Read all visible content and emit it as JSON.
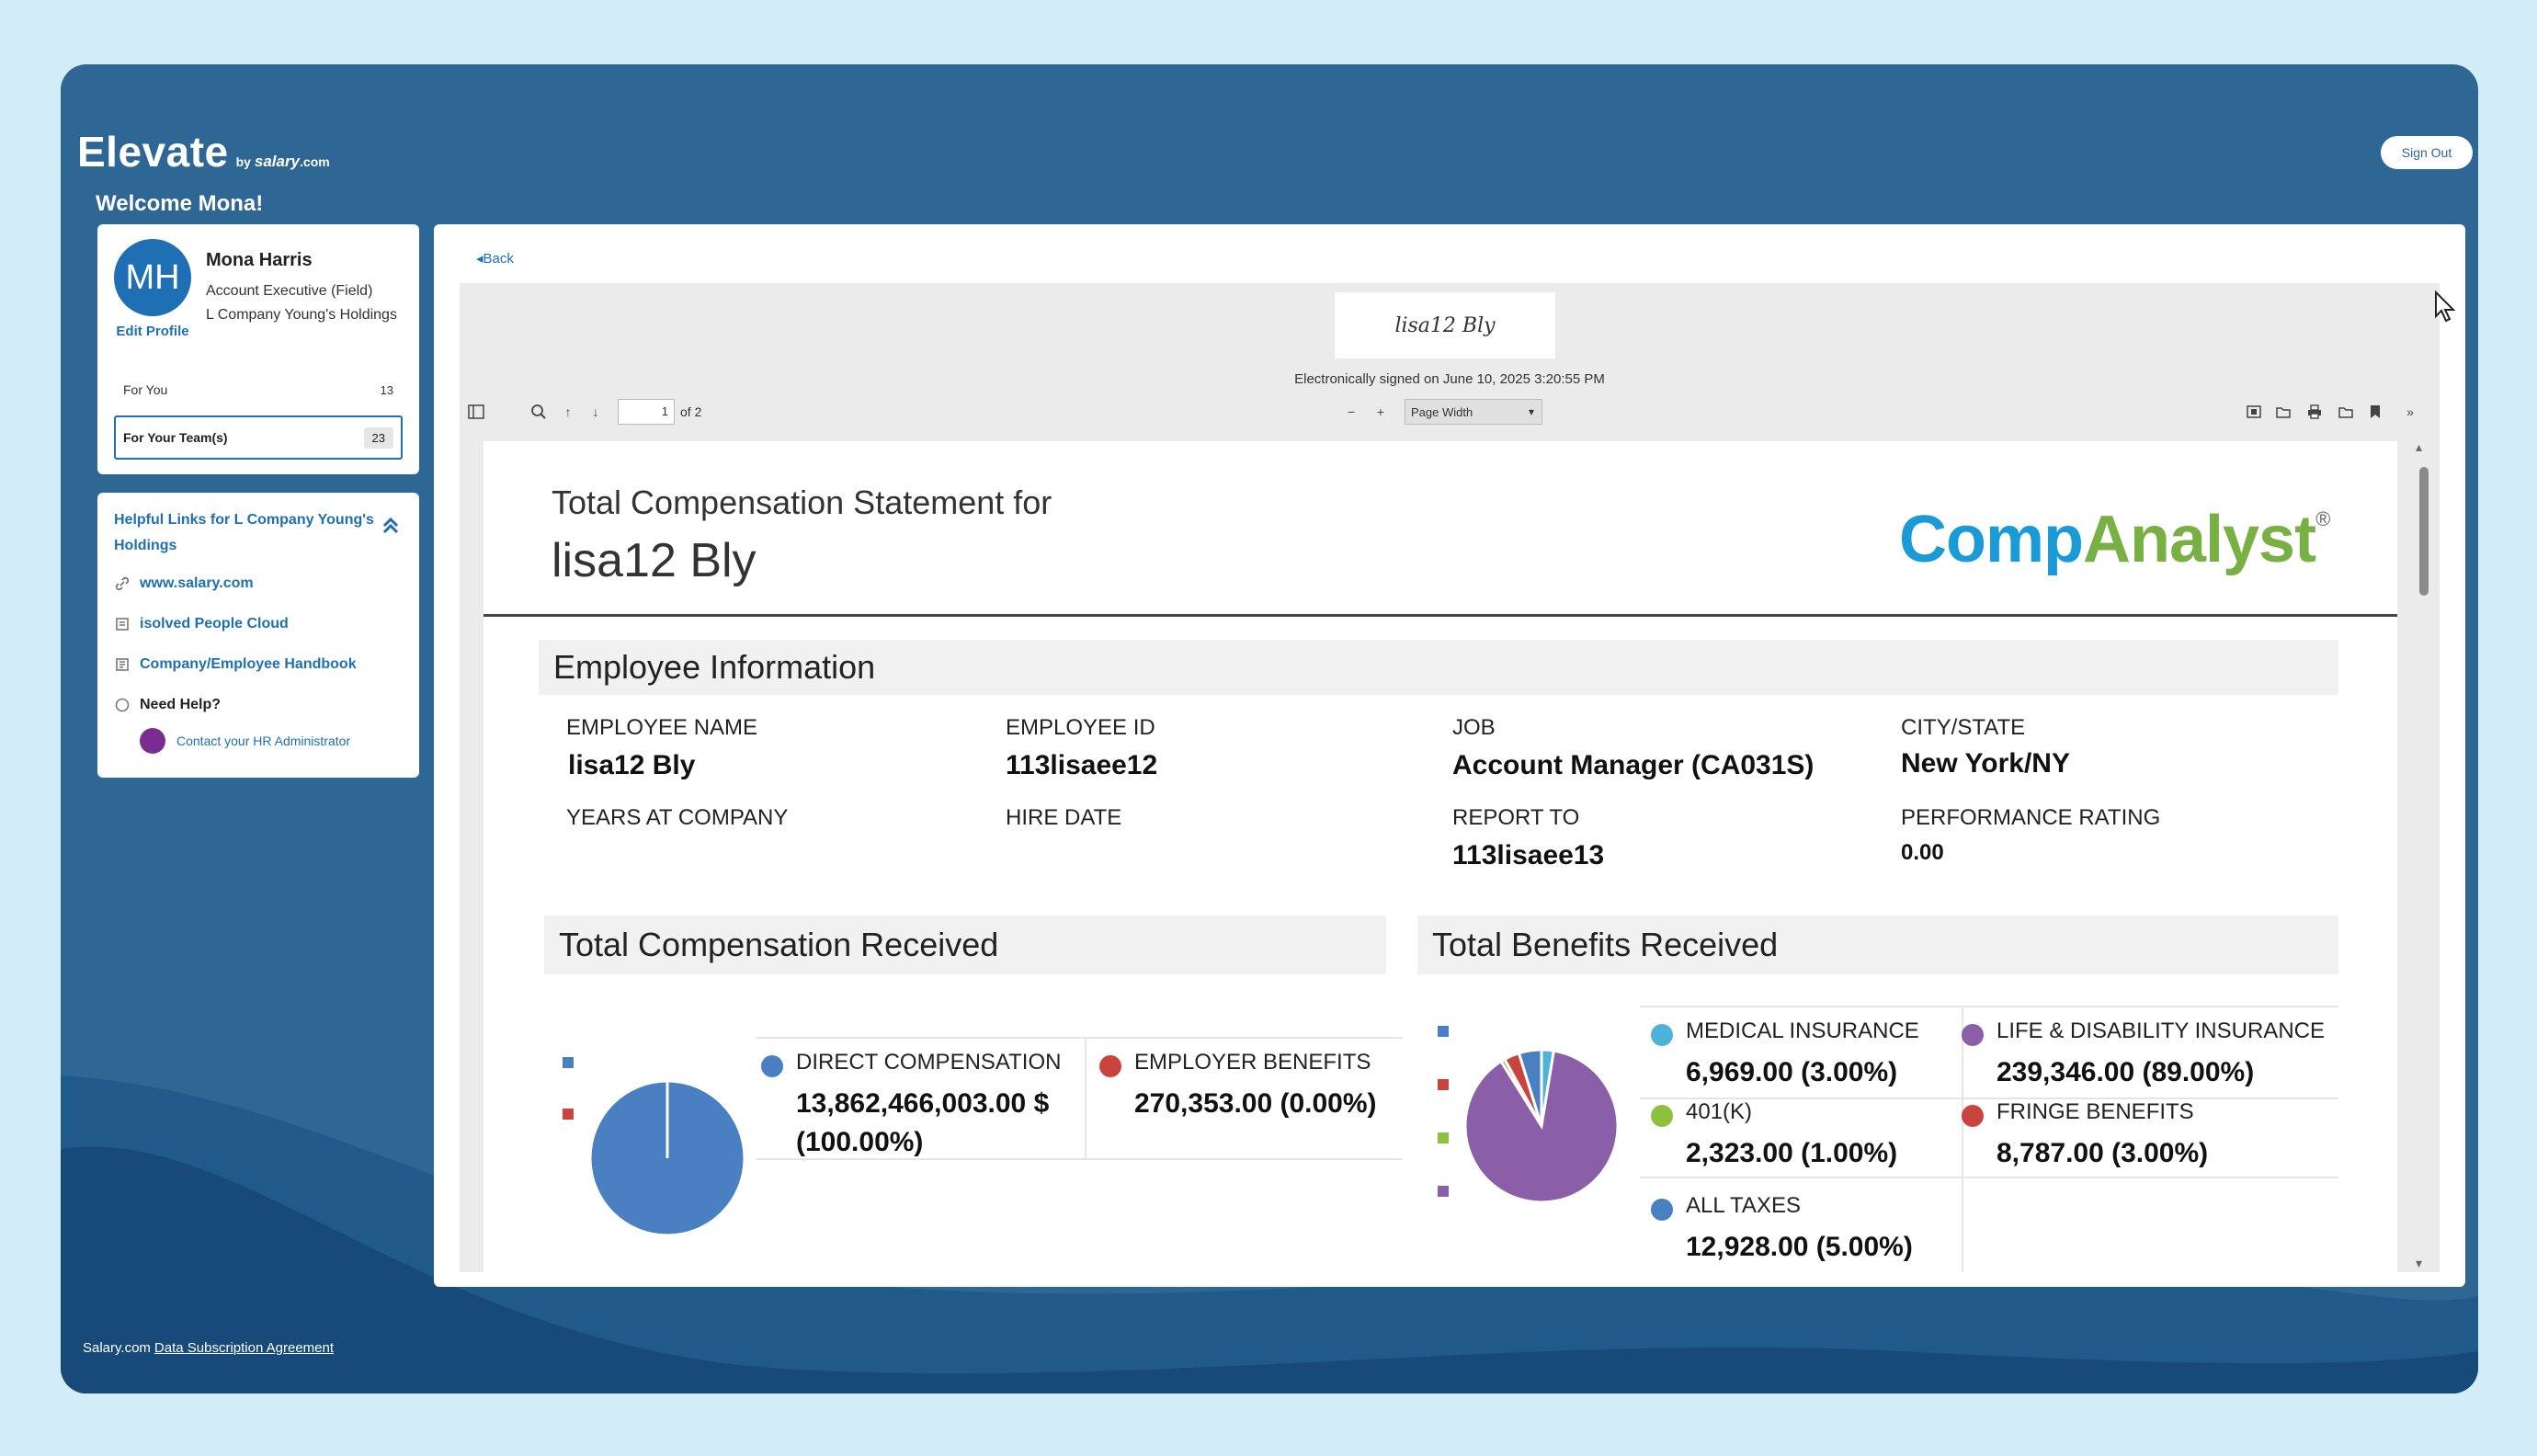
{
  "app": {
    "brand": "Elevate",
    "by": "by",
    "by_brand": "salary",
    "by_suffix": ".com",
    "welcome": "Welcome Mona!",
    "sign_out": "Sign Out"
  },
  "profile": {
    "initials": "MH",
    "name": "Mona Harris",
    "title": "Account Executive (Field)",
    "company": "L Company Young's Holdings",
    "edit": "Edit Profile",
    "for_you": "For You",
    "for_you_count": "13",
    "for_team": "For Your Team(s)",
    "for_team_count": "23"
  },
  "links": {
    "title": "Helpful Links for L Company Young's Holdings",
    "items": [
      {
        "label": "www.salary.com",
        "icon": "link-icon"
      },
      {
        "label": "isolved People Cloud",
        "icon": "cloud-doc-icon"
      },
      {
        "label": "Company/Employee Handbook",
        "icon": "handbook-icon"
      }
    ],
    "need_help": "Need Help?",
    "contact": "Contact your HR Administrator"
  },
  "footer": {
    "company": "Salary.com",
    "agreement": "Data Subscription Agreement"
  },
  "viewer": {
    "back": "Back",
    "signature": "lisa12 Bly",
    "signed_text": "Electronically signed on June 10, 2025 3:20:55 PM",
    "page_current": "1",
    "page_total": "of 2",
    "zoom": "Page Width"
  },
  "statement": {
    "title": "Total Compensation Statement for",
    "name": "lisa12 Bly",
    "logo_a": "Comp",
    "logo_b": "Analyst",
    "logo_reg": "®",
    "employee_section": "Employee Information",
    "fields": {
      "employee_name_label": "EMPLOYEE NAME",
      "employee_name": "lisa12 Bly",
      "employee_id_label": "EMPLOYEE ID",
      "employee_id": "113lisaee12",
      "job_label": "JOB",
      "job": "Account Manager (CA031S)",
      "city_label": "CITY/STATE",
      "city": "New York/NY",
      "years_label": "YEARS AT COMPANY",
      "hire_label": "HIRE DATE",
      "report_label": "REPORT TO",
      "report": "113lisaee13",
      "perf_label": "PERFORMANCE RATING",
      "perf": "0.00"
    },
    "comp_section": "Total Compensation Received",
    "benefits_section": "Total Benefits Received"
  },
  "chart_data": [
    {
      "type": "pie",
      "title": "Total Compensation Received",
      "categories": [
        "DIRECT COMPENSATION",
        "EMPLOYER BENEFITS"
      ],
      "values": [
        13862466003.0,
        270353.0
      ],
      "labels": [
        "13,862,466,003.00 $ (100.00%)",
        "270,353.00 (0.00%)"
      ],
      "colors": [
        "#4a7fc1",
        "#c9433f"
      ],
      "legend": "right"
    },
    {
      "type": "pie",
      "title": "Total Benefits Received",
      "categories": [
        "MEDICAL INSURANCE",
        "LIFE & DISABILITY INSURANCE",
        "401(K)",
        "FRINGE BENEFITS",
        "ALL TAXES"
      ],
      "values": [
        6969.0,
        239346.0,
        2323.0,
        8787.0,
        12928.0
      ],
      "labels": [
        "6,969.00 (3.00%)",
        "239,346.00 (89.00%)",
        "2,323.00 (1.00%)",
        "8,787.00 (3.00%)",
        "12,928.00 (5.00%)"
      ],
      "colors": [
        "#4fb3d9",
        "#8a5fa8",
        "#8fbf3f",
        "#c9433f",
        "#4a7fc1"
      ],
      "legend": "right"
    }
  ]
}
